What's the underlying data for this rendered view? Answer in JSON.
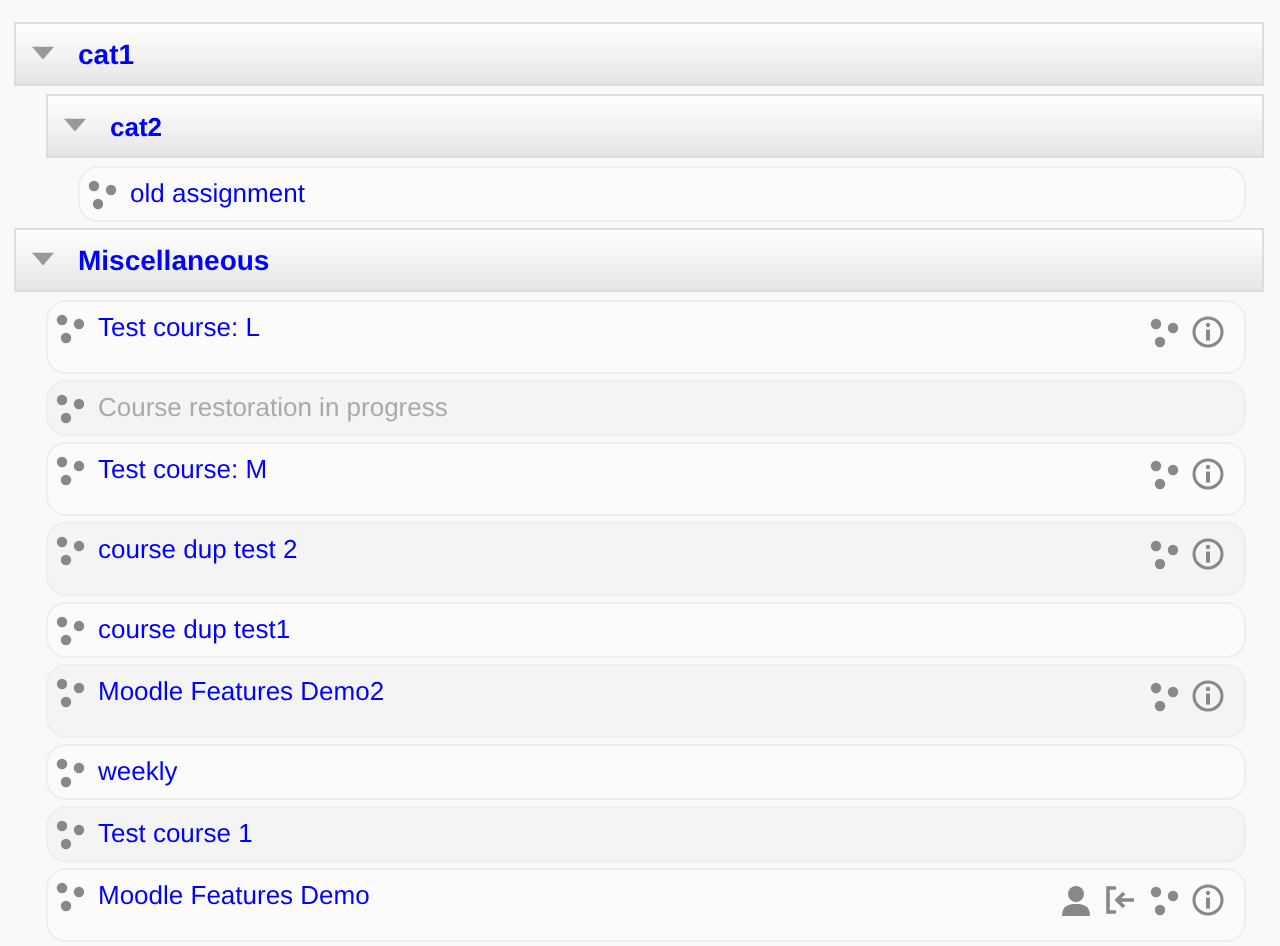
{
  "categories": [
    {
      "name": "cat1",
      "expanded": true,
      "children": [
        {
          "name": "cat2",
          "expanded": true,
          "courses": [
            {
              "name": "old assignment",
              "disabled": false
            }
          ]
        }
      ]
    },
    {
      "name": "Miscellaneous",
      "expanded": true,
      "courses": [
        {
          "name": "Test course: L",
          "disabled": false,
          "network": true,
          "info": true
        },
        {
          "name": "Course restoration in progress",
          "disabled": true
        },
        {
          "name": "Test course: M",
          "disabled": false,
          "network": true,
          "info": true
        },
        {
          "name": "course dup test 2",
          "disabled": false,
          "network": true,
          "info": true
        },
        {
          "name": "course dup test1",
          "disabled": false
        },
        {
          "name": "Moodle Features Demo2",
          "disabled": false,
          "network": true,
          "info": true
        },
        {
          "name": "weekly",
          "disabled": false
        },
        {
          "name": "Test course 1",
          "disabled": false
        },
        {
          "name": "Moodle Features Demo",
          "disabled": false,
          "guest": true,
          "self_enrol": true,
          "network": true,
          "info": true
        }
      ]
    }
  ]
}
